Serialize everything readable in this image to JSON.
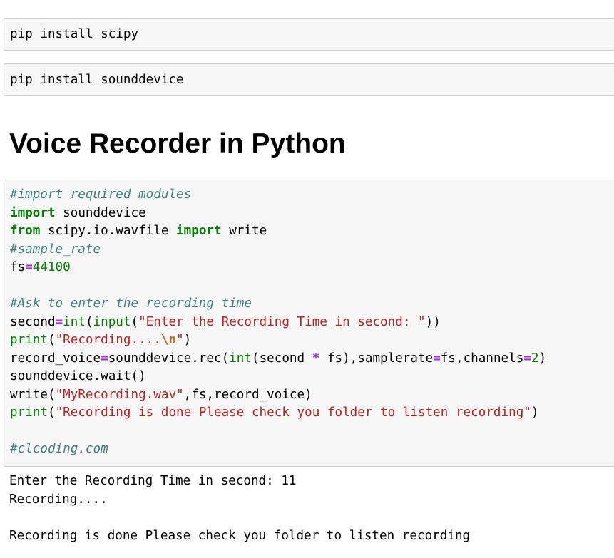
{
  "cells": {
    "install_scipy": "pip install scipy",
    "install_sounddevice": "pip install sounddevice"
  },
  "heading": "Voice Recorder in Python",
  "code": {
    "comment_import": "#import required modules",
    "kw_import": "import",
    "mod_sounddevice": " sounddevice",
    "kw_from": "from",
    "mod_scipy": " scipy.io.wavfile ",
    "kw_import2": "import",
    "name_write": " write",
    "comment_sample_rate": "#sample_rate",
    "var_fs": "fs",
    "op_eq": "=",
    "num_fs": "44100",
    "comment_ask": "#Ask to enter the recording time",
    "var_second": "second",
    "bi_int": "int",
    "paren_open": "(",
    "bi_input": "input",
    "str_prompt": "\"Enter the Recording Time in second: \"",
    "paren_close2": "))",
    "bi_print": "print",
    "str_recording_a": "\"Recording....",
    "str_recording_esc": "\\n",
    "str_recording_b": "\"",
    "paren_close": ")",
    "var_record_voice": "record_voice",
    "call_rec": "sounddevice.rec(",
    "call_rec_args_a": "second ",
    "op_mul": "*",
    "call_rec_args_b": " fs),samplerate",
    "call_rec_args_c": "fs,channels",
    "num_channels": "2",
    "call_wait": "sounddevice.wait()",
    "call_write": "write(",
    "str_filename": "\"MyRecording.wav\"",
    "call_write_args": ",fs,record_voice)",
    "str_done": "\"Recording is done Please check you folder to listen recording\"",
    "comment_site": "#clcoding.com"
  },
  "output": {
    "line1": "Enter the Recording Time in second: 11",
    "line2": "Recording....",
    "line3": "",
    "line4": "Recording is done Please check you folder to listen recording"
  }
}
